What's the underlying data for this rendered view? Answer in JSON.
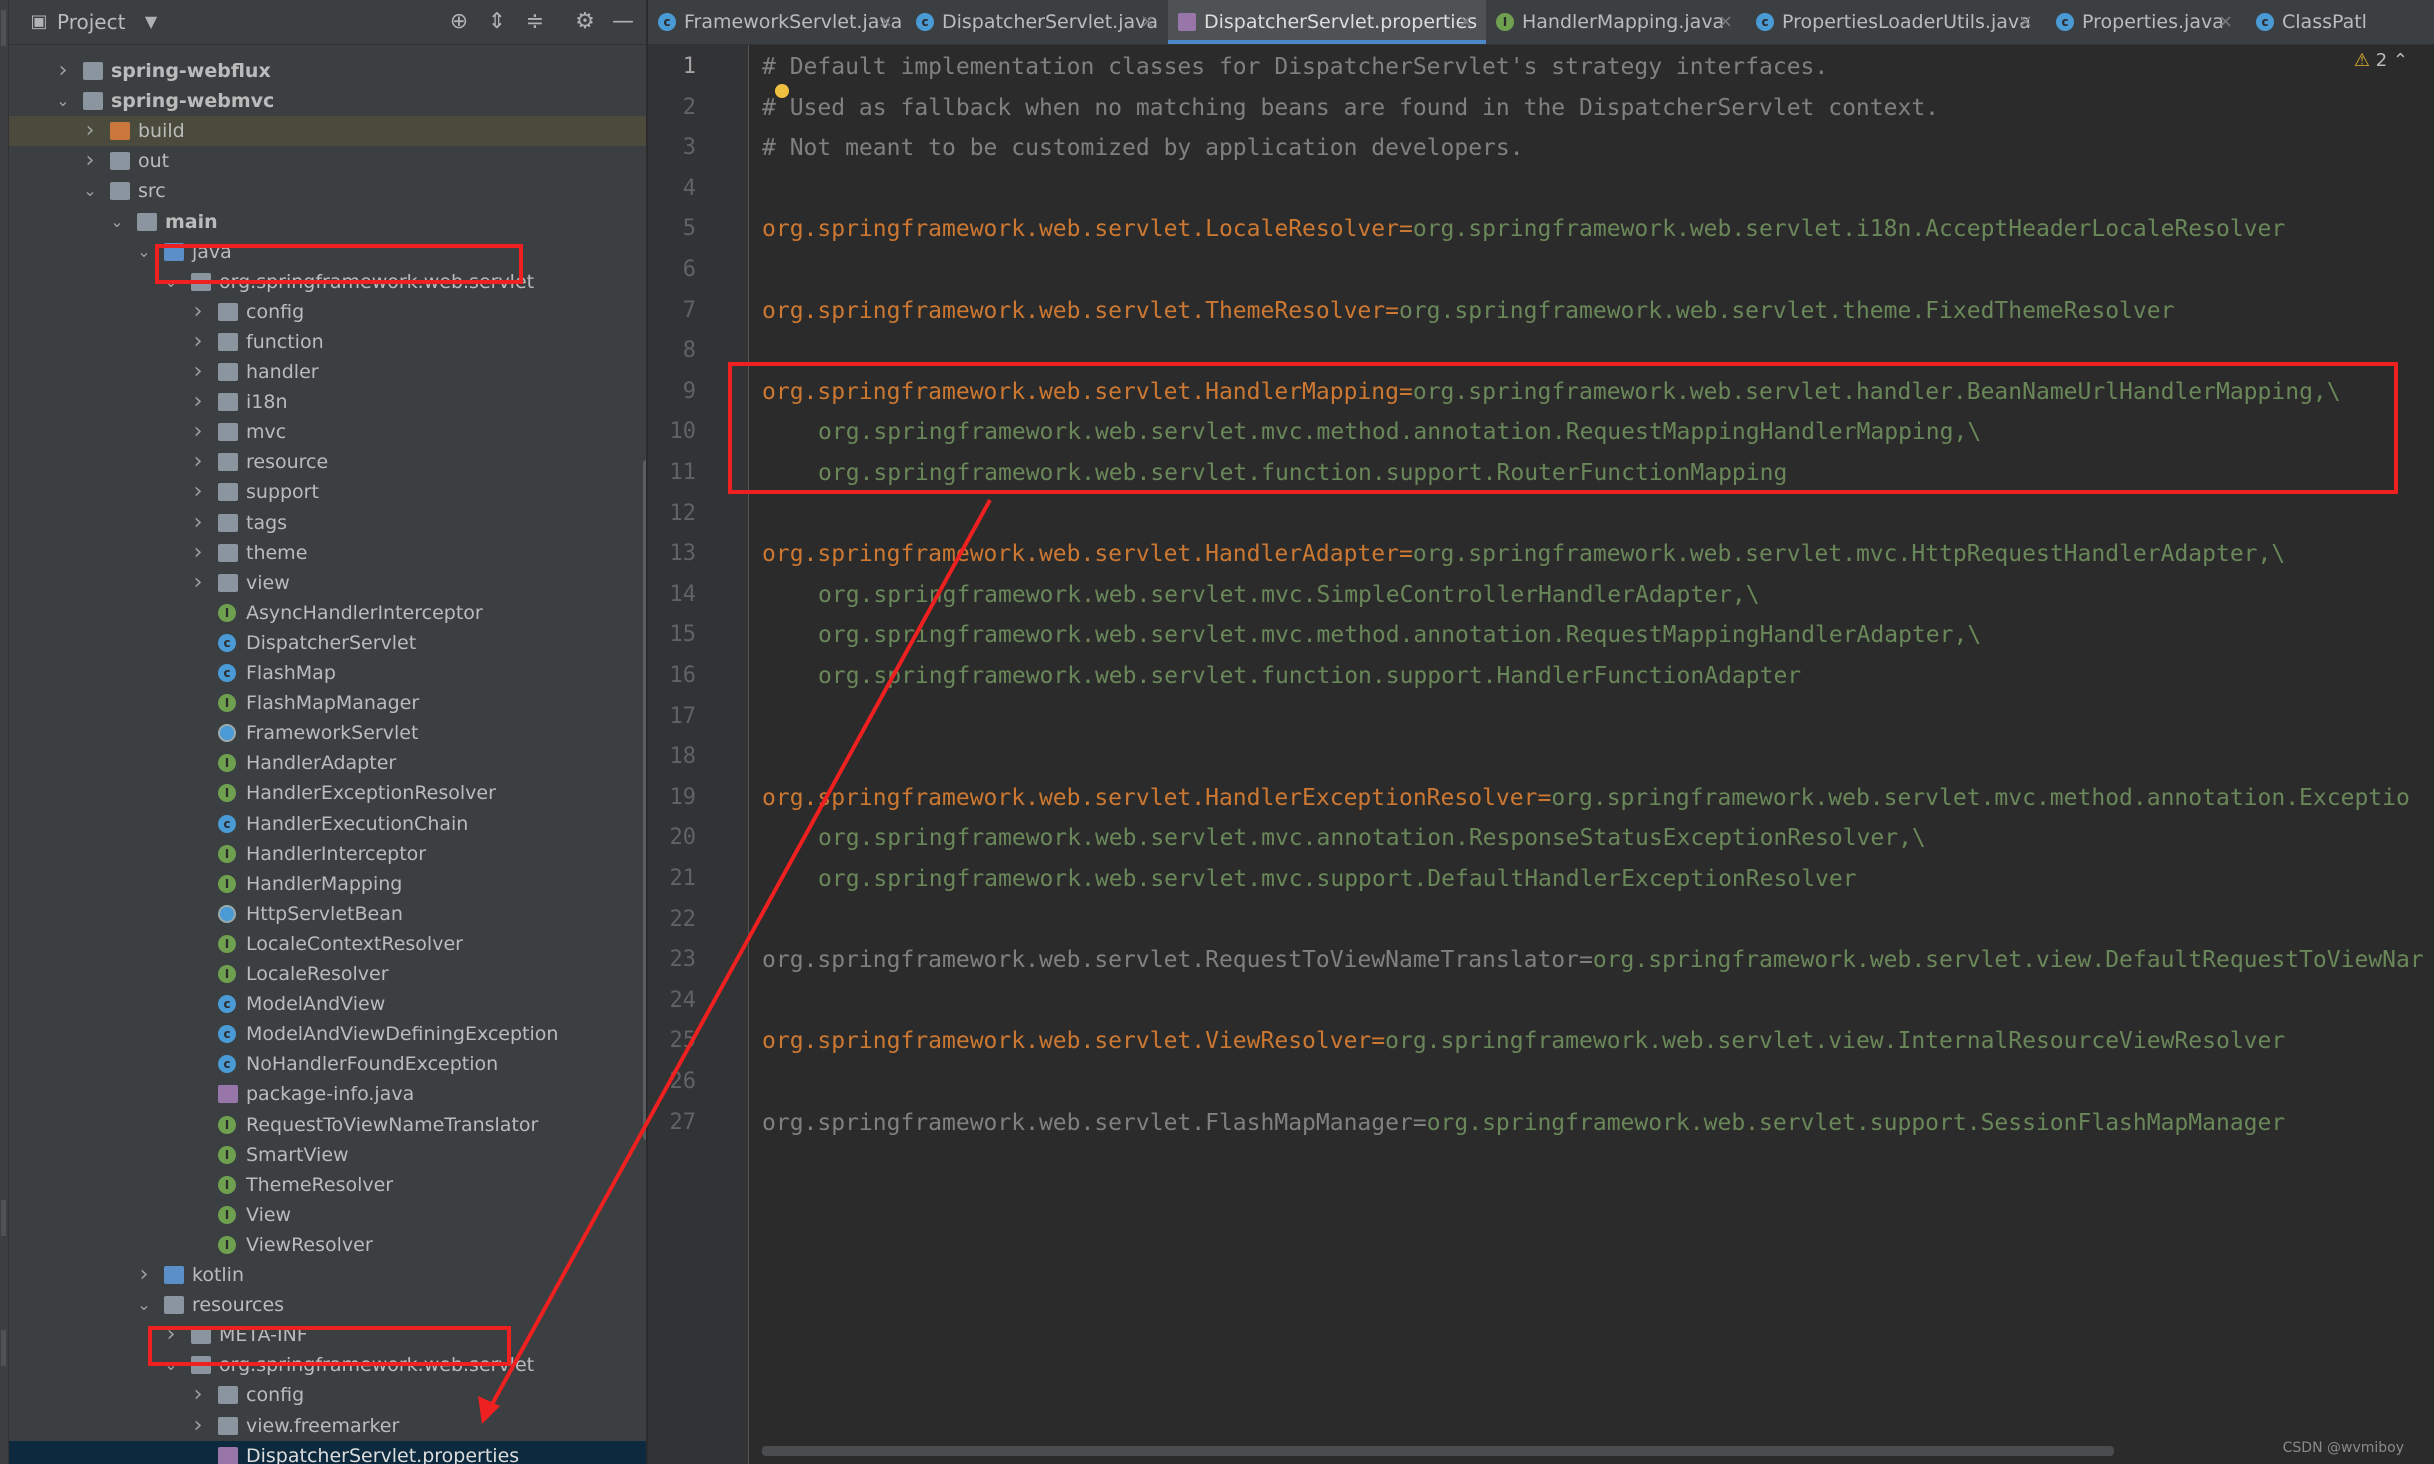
{
  "project_panel": {
    "title": "Project",
    "tree": [
      {
        "label": "spring-webflux",
        "bold": true,
        "indent": 0,
        "arrow": "right",
        "icon": "module"
      },
      {
        "label": "spring-webmvc",
        "bold": true,
        "indent": 0,
        "arrow": "down",
        "icon": "module"
      },
      {
        "label": "build",
        "indent": 1,
        "arrow": "right",
        "icon": "folder-orange",
        "highlight": "light"
      },
      {
        "label": "out",
        "indent": 1,
        "arrow": "right",
        "icon": "folder"
      },
      {
        "label": "src",
        "indent": 1,
        "arrow": "down",
        "icon": "folder"
      },
      {
        "label": "main",
        "bold": true,
        "indent": 2,
        "arrow": "down",
        "icon": "folder"
      },
      {
        "label": "java",
        "indent": 3,
        "arrow": "down",
        "icon": "folder-blue"
      },
      {
        "label": "org.springframework.web.servlet",
        "indent": 4,
        "arrow": "down",
        "icon": "package"
      },
      {
        "label": "config",
        "indent": 5,
        "arrow": "right",
        "icon": "package"
      },
      {
        "label": "function",
        "indent": 5,
        "arrow": "right",
        "icon": "package"
      },
      {
        "label": "handler",
        "indent": 5,
        "arrow": "right",
        "icon": "package"
      },
      {
        "label": "i18n",
        "indent": 5,
        "arrow": "right",
        "icon": "package"
      },
      {
        "label": "mvc",
        "indent": 5,
        "arrow": "right",
        "icon": "package"
      },
      {
        "label": "resource",
        "indent": 5,
        "arrow": "right",
        "icon": "package"
      },
      {
        "label": "support",
        "indent": 5,
        "arrow": "right",
        "icon": "package"
      },
      {
        "label": "tags",
        "indent": 5,
        "arrow": "right",
        "icon": "package"
      },
      {
        "label": "theme",
        "indent": 5,
        "arrow": "right",
        "icon": "package"
      },
      {
        "label": "view",
        "indent": 5,
        "arrow": "right",
        "icon": "package"
      },
      {
        "label": "AsyncHandlerInterceptor",
        "indent": 5,
        "icon": "interface"
      },
      {
        "label": "DispatcherServlet",
        "indent": 5,
        "icon": "class"
      },
      {
        "label": "FlashMap",
        "indent": 5,
        "icon": "class"
      },
      {
        "label": "FlashMapManager",
        "indent": 5,
        "icon": "interface"
      },
      {
        "label": "FrameworkServlet",
        "indent": 5,
        "icon": "abstract"
      },
      {
        "label": "HandlerAdapter",
        "indent": 5,
        "icon": "interface"
      },
      {
        "label": "HandlerExceptionResolver",
        "indent": 5,
        "icon": "interface"
      },
      {
        "label": "HandlerExecutionChain",
        "indent": 5,
        "icon": "class"
      },
      {
        "label": "HandlerInterceptor",
        "indent": 5,
        "icon": "interface"
      },
      {
        "label": "HandlerMapping",
        "indent": 5,
        "icon": "interface"
      },
      {
        "label": "HttpServletBean",
        "indent": 5,
        "icon": "abstract"
      },
      {
        "label": "LocaleContextResolver",
        "indent": 5,
        "icon": "interface"
      },
      {
        "label": "LocaleResolver",
        "indent": 5,
        "icon": "interface"
      },
      {
        "label": "ModelAndView",
        "indent": 5,
        "icon": "class"
      },
      {
        "label": "ModelAndViewDefiningException",
        "indent": 5,
        "icon": "class"
      },
      {
        "label": "NoHandlerFoundException",
        "indent": 5,
        "icon": "class"
      },
      {
        "label": "package-info.java",
        "indent": 5,
        "icon": "file"
      },
      {
        "label": "RequestToViewNameTranslator",
        "indent": 5,
        "icon": "interface"
      },
      {
        "label": "SmartView",
        "indent": 5,
        "icon": "interface"
      },
      {
        "label": "ThemeResolver",
        "indent": 5,
        "icon": "interface"
      },
      {
        "label": "View",
        "indent": 5,
        "icon": "interface"
      },
      {
        "label": "ViewResolver",
        "indent": 5,
        "icon": "interface"
      },
      {
        "label": "kotlin",
        "indent": 3,
        "arrow": "right",
        "icon": "folder-blue"
      },
      {
        "label": "resources",
        "indent": 3,
        "arrow": "down",
        "icon": "folder"
      },
      {
        "label": "META-INF",
        "indent": 4,
        "arrow": "right",
        "icon": "folder"
      },
      {
        "label": "org.springframework.web.servlet",
        "indent": 4,
        "arrow": "down",
        "icon": "folder"
      },
      {
        "label": "config",
        "indent": 5,
        "arrow": "right",
        "icon": "folder"
      },
      {
        "label": "view.freemarker",
        "indent": 5,
        "arrow": "right",
        "icon": "folder"
      },
      {
        "label": "DispatcherServlet.properties",
        "indent": 5,
        "icon": "properties",
        "highlight": "selected"
      }
    ]
  },
  "tabs": [
    {
      "label": "FrameworkServlet.java",
      "icon": "class"
    },
    {
      "label": "DispatcherServlet.java",
      "icon": "class"
    },
    {
      "label": "DispatcherServlet.properties",
      "icon": "properties",
      "active": true
    },
    {
      "label": "HandlerMapping.java",
      "icon": "interface"
    },
    {
      "label": "PropertiesLoaderUtils.java",
      "icon": "class"
    },
    {
      "label": "Properties.java",
      "icon": "class"
    },
    {
      "label": "ClassPatl",
      "icon": "class"
    }
  ],
  "editor": {
    "warnings": "2",
    "current_line": 1,
    "lines": [
      {
        "n": "1",
        "t": "comment",
        "text": "# Default implementation classes for DispatcherServlet's strategy interfaces."
      },
      {
        "n": "2",
        "t": "comment",
        "text": "# Used as fallback when no matching beans are found in the DispatcherServlet context."
      },
      {
        "n": "3",
        "t": "comment",
        "text": "# Not meant to be customized by application developers."
      },
      {
        "n": "4",
        "t": "blank"
      },
      {
        "n": "5",
        "t": "kv",
        "key": "org.springframework.web.servlet.LocaleResolver",
        "value": "org.springframework.web.servlet.i18n.AcceptHeaderLocaleResolver"
      },
      {
        "n": "6",
        "t": "blank"
      },
      {
        "n": "7",
        "t": "kv",
        "key": "org.springframework.web.servlet.ThemeResolver",
        "value": "org.springframework.web.servlet.theme.FixedThemeResolver"
      },
      {
        "n": "8",
        "t": "blank"
      },
      {
        "n": "9",
        "t": "kv",
        "key": "org.springframework.web.servlet.HandlerMapping",
        "value": "org.springframework.web.servlet.handler.BeanNameUrlHandlerMapping,\\"
      },
      {
        "n": "10",
        "t": "cont",
        "value": "org.springframework.web.servlet.mvc.method.annotation.RequestMappingHandlerMapping,\\"
      },
      {
        "n": "11",
        "t": "cont",
        "value": "org.springframework.web.servlet.function.support.RouterFunctionMapping"
      },
      {
        "n": "12",
        "t": "blank"
      },
      {
        "n": "13",
        "t": "kv",
        "key": "org.springframework.web.servlet.HandlerAdapter",
        "value": "org.springframework.web.servlet.mvc.HttpRequestHandlerAdapter,\\"
      },
      {
        "n": "14",
        "t": "cont",
        "value": "org.springframework.web.servlet.mvc.SimpleControllerHandlerAdapter,\\"
      },
      {
        "n": "15",
        "t": "cont",
        "value": "org.springframework.web.servlet.mvc.method.annotation.RequestMappingHandlerAdapter,\\"
      },
      {
        "n": "16",
        "t": "cont",
        "value": "org.springframework.web.servlet.function.support.HandlerFunctionAdapter"
      },
      {
        "n": "17",
        "t": "blank"
      },
      {
        "n": "18",
        "t": "blank"
      },
      {
        "n": "19",
        "t": "kv",
        "key": "org.springframework.web.servlet.HandlerExceptionResolver",
        "value": "org.springframework.web.servlet.mvc.method.annotation.Exceptio"
      },
      {
        "n": "20",
        "t": "cont",
        "value": "org.springframework.web.servlet.mvc.annotation.ResponseStatusExceptionResolver,\\"
      },
      {
        "n": "21",
        "t": "cont",
        "value": "org.springframework.web.servlet.mvc.support.DefaultHandlerExceptionResolver"
      },
      {
        "n": "22",
        "t": "blank"
      },
      {
        "n": "23",
        "t": "kvgray",
        "key": "org.springframework.web.servlet.RequestToViewNameTranslator",
        "value": "org.springframework.web.servlet.view.DefaultRequestToViewNar"
      },
      {
        "n": "24",
        "t": "blank"
      },
      {
        "n": "25",
        "t": "kv",
        "key": "org.springframework.web.servlet.ViewResolver",
        "value": "org.springframework.web.servlet.view.InternalResourceViewResolver"
      },
      {
        "n": "26",
        "t": "blank"
      },
      {
        "n": "27",
        "t": "kvgray",
        "key": "org.springframework.web.servlet.FlashMapManager",
        "value": "org.springframework.web.servlet.support.SessionFlashMapManager"
      }
    ]
  },
  "watermark": "CSDN @wvmiboy",
  "colors": {
    "annotation": "#ee2020",
    "key": "#cc7832",
    "value": "#6a8759",
    "comment": "#808080"
  }
}
